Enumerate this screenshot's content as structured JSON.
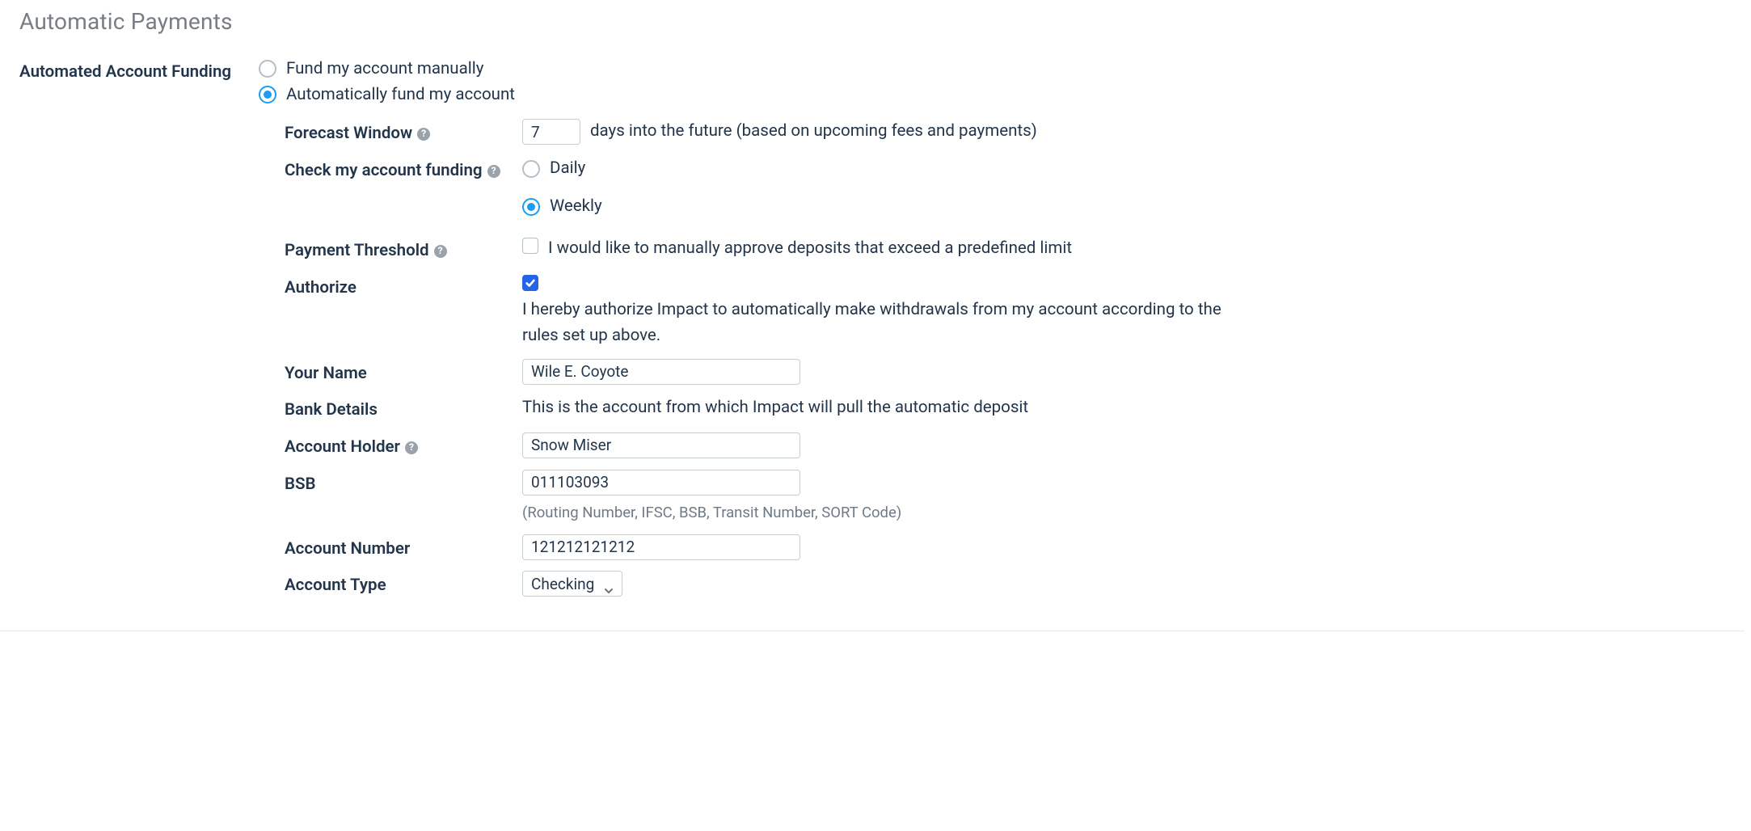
{
  "section": {
    "title": "Automatic Payments"
  },
  "funding": {
    "label": "Automated Account Funding",
    "options": {
      "manual": "Fund my account manually",
      "auto": "Automatically fund my account"
    },
    "selected": "auto"
  },
  "forecast": {
    "label": "Forecast Window",
    "value": "7",
    "suffix": "days into the future (based on upcoming fees and payments)"
  },
  "check_funding": {
    "label": "Check my account funding",
    "options": {
      "daily": "Daily",
      "weekly": "Weekly"
    },
    "selected": "weekly"
  },
  "threshold": {
    "label": "Payment Threshold",
    "checkbox_label": "I would like to manually approve deposits that exceed a predefined limit",
    "checked": false
  },
  "authorize": {
    "label": "Authorize",
    "checked": true,
    "text": "I hereby authorize Impact to automatically make withdrawals from my account according to the rules set up above."
  },
  "your_name": {
    "label": "Your Name",
    "value": "Wile E. Coyote"
  },
  "bank_details": {
    "label": "Bank Details",
    "text": "This is the account from which Impact will pull the automatic deposit"
  },
  "account_holder": {
    "label": "Account Holder",
    "value": "Snow Miser"
  },
  "bsb": {
    "label": "BSB",
    "value": "011103093",
    "hint": "(Routing Number, IFSC, BSB, Transit Number, SORT Code)"
  },
  "account_number": {
    "label": "Account Number",
    "value": "121212121212"
  },
  "account_type": {
    "label": "Account Type",
    "value": "Checking"
  }
}
